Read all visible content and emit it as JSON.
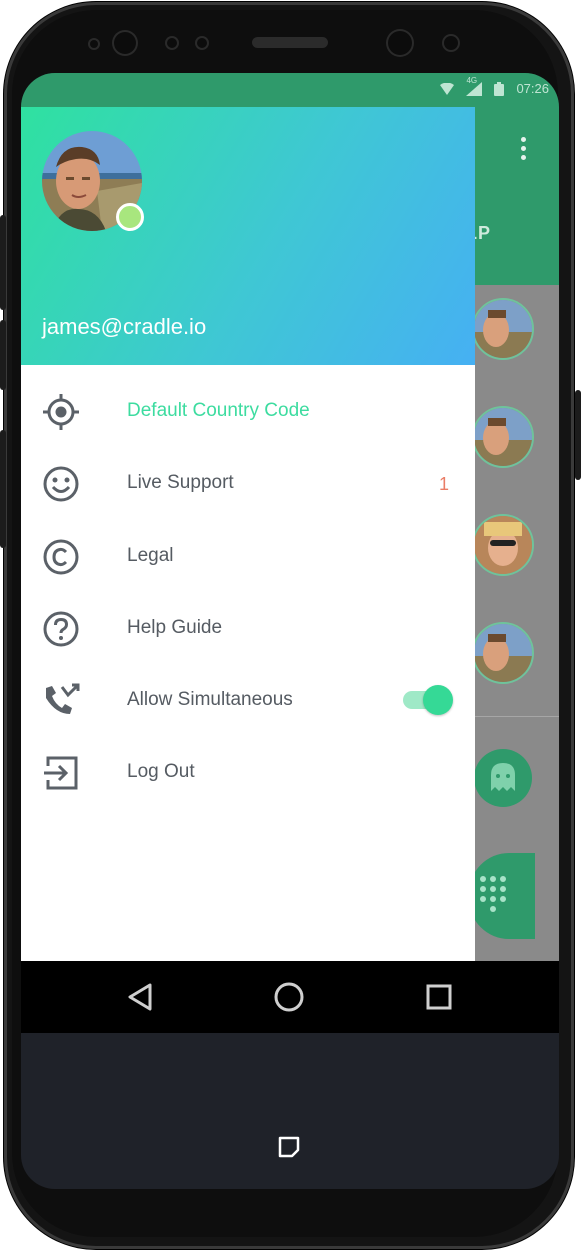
{
  "status_bar": {
    "network": "4G",
    "time": "07:26"
  },
  "app_bar": {
    "tab_label_partial": "LP"
  },
  "drawer": {
    "email": "james@cradle.io",
    "menu": [
      {
        "label": "Default Country Code",
        "icon": "crosshair-icon",
        "active": true
      },
      {
        "label": "Live Support",
        "icon": "smiley-icon",
        "badge": "1"
      },
      {
        "label": "Legal",
        "icon": "copyright-icon"
      },
      {
        "label": "Help Guide",
        "icon": "help-circle-icon"
      },
      {
        "label": "Allow Simultaneous",
        "icon": "call-merge-icon",
        "toggle_on": true
      },
      {
        "label": "Log Out",
        "icon": "logout-icon"
      }
    ]
  },
  "colors": {
    "accent": "#3ddca0",
    "primary": "#2f9a6b",
    "badge": "#ea7d66",
    "text": "#555b62"
  }
}
